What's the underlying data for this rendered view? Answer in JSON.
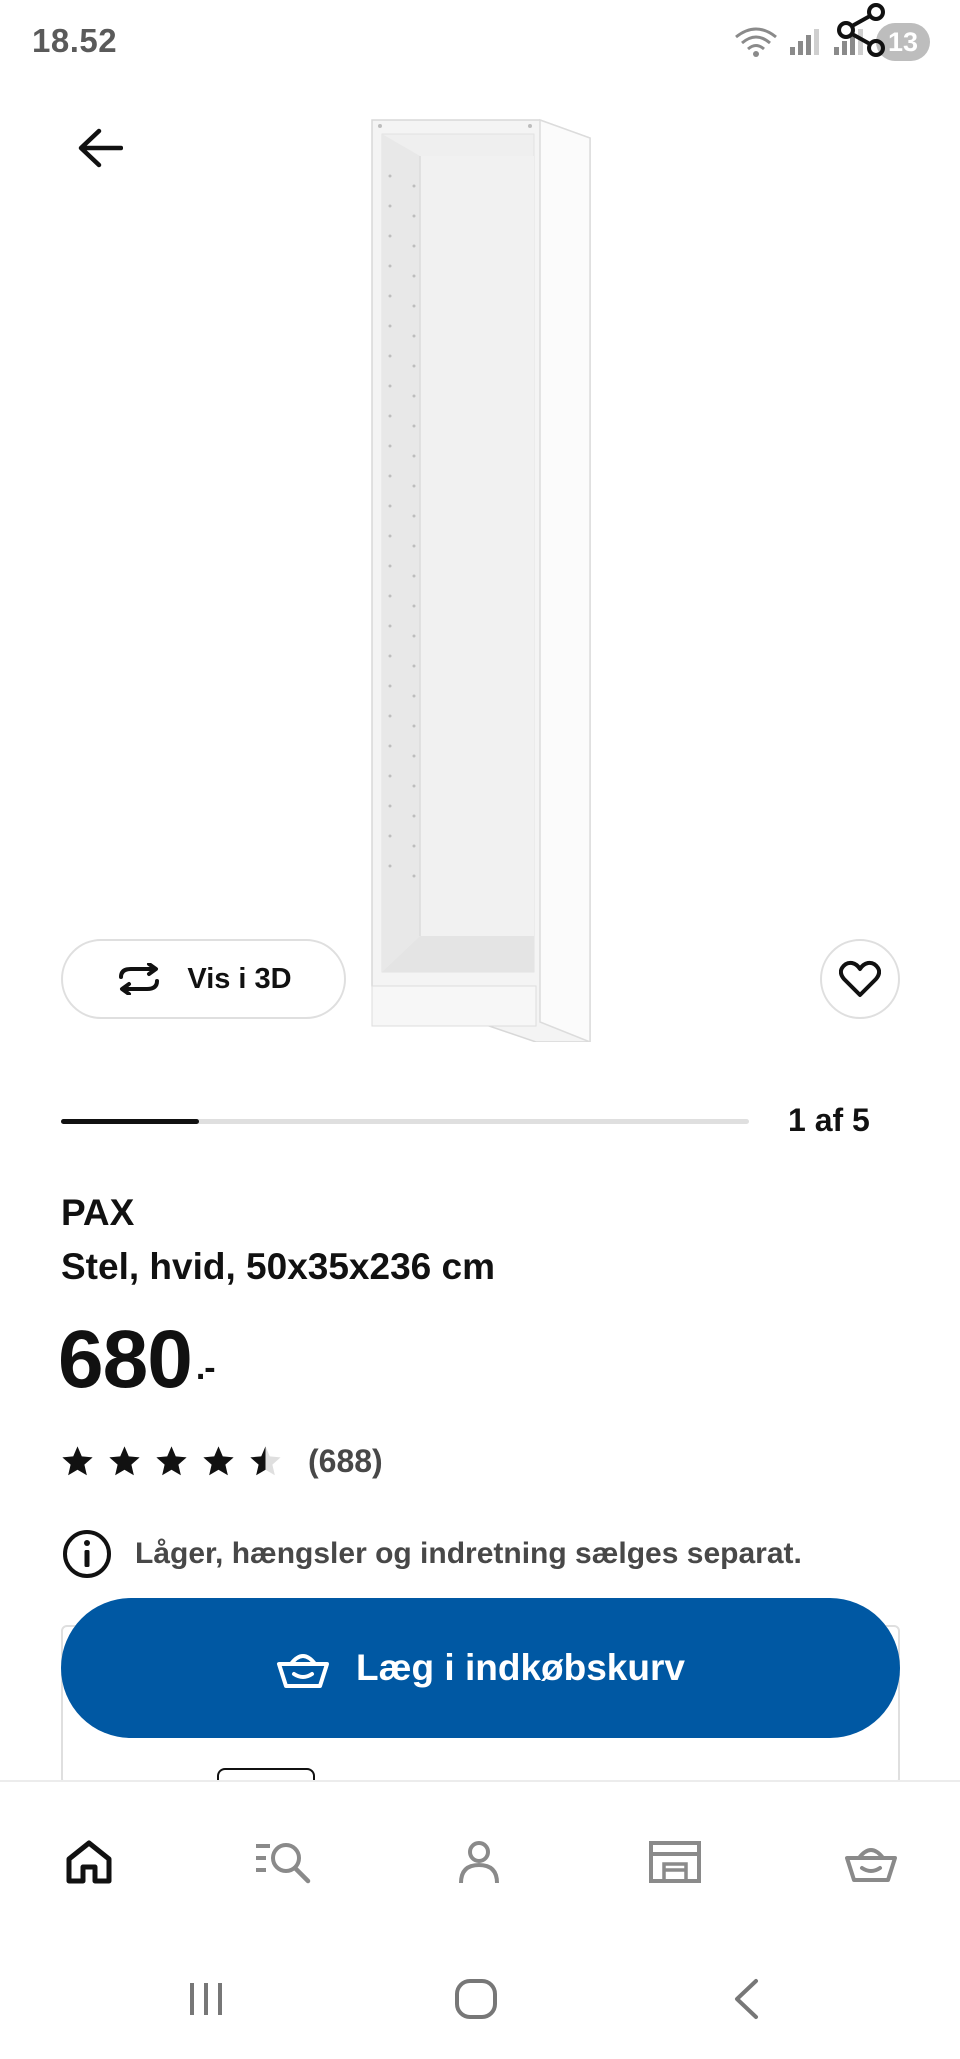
{
  "status_bar": {
    "time": "18.52",
    "notification_count": "13"
  },
  "hero": {
    "view_3d_label": "Vis i 3D",
    "image_alt": "PAX Stel, hvid, 50x35x236 cm"
  },
  "carousel": {
    "label": "1 af 5",
    "current": 1,
    "total": 5
  },
  "product": {
    "name": "PAX",
    "description": "Stel, hvid, 50x35x236 cm",
    "price": "680",
    "price_suffix": ".-",
    "rating": 4.5,
    "rating_max": 5,
    "review_count": "(688)",
    "info_notice": "Låger, hængsler og indretning sælges separat."
  },
  "cta": {
    "add_to_cart_label": "Læg i indkøbskurv"
  },
  "bottom_nav": {
    "items": [
      {
        "id": "home",
        "icon": "home-icon",
        "active": true
      },
      {
        "id": "search",
        "icon": "search-list-icon",
        "active": false
      },
      {
        "id": "profile",
        "icon": "person-icon",
        "active": false
      },
      {
        "id": "store",
        "icon": "store-icon",
        "active": false
      },
      {
        "id": "cart",
        "icon": "basket-icon",
        "active": false
      }
    ]
  },
  "system_nav": {
    "buttons": [
      "recent-apps-icon",
      "home-circle-icon",
      "back-chevron-icon"
    ]
  },
  "colors": {
    "primary": "#0058a3",
    "text": "#111111",
    "muted": "#484848",
    "border": "#dfdfdf"
  }
}
